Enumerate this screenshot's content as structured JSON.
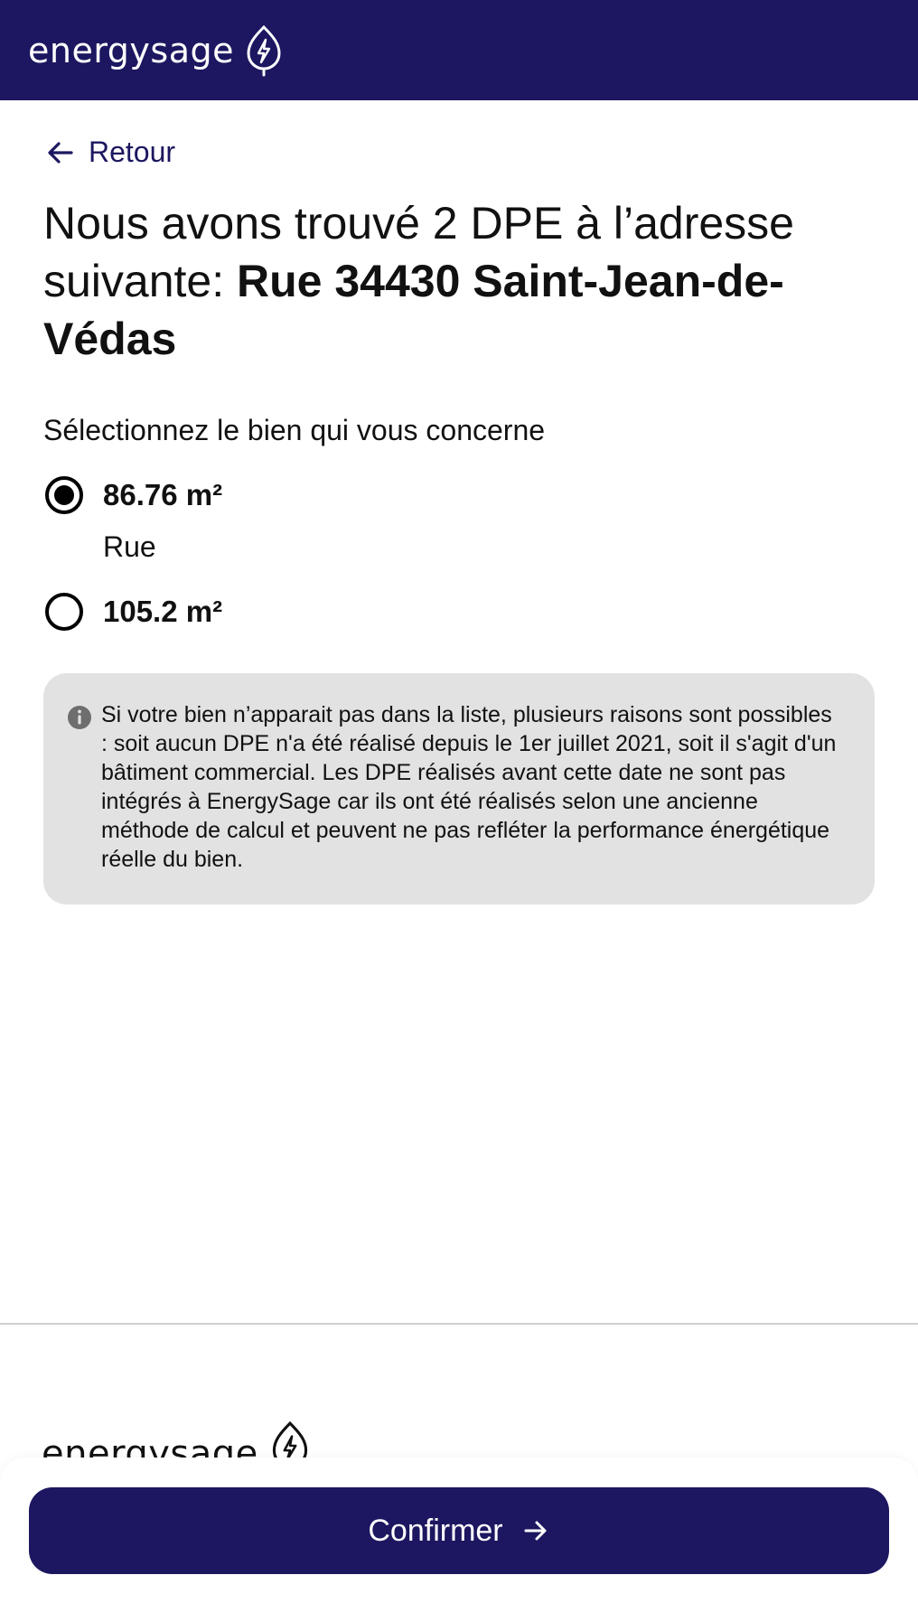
{
  "header": {
    "brand_name": "energysage",
    "logo_icon": "leaf-bolt-icon",
    "background": "#1c1760"
  },
  "nav": {
    "back_label": "Retour",
    "back_icon": "arrow-left-icon"
  },
  "main": {
    "title_prefix": "Nous avons trouvé 2 DPE à l’adresse suivante: ",
    "title_address": "Rue 34430 Saint-Jean-de-Védas",
    "subtitle": "Sélectionnez le bien qui vous concerne",
    "options": [
      {
        "area": "86.76 m²",
        "street": "Rue",
        "selected": true
      },
      {
        "area": "105.2 m²",
        "street": "",
        "selected": false
      }
    ],
    "info_icon": "info-icon",
    "info_text": "Si votre bien n’apparait pas dans la liste, plusieurs raisons sont possibles : soit aucun DPE n'a été réalisé depuis le 1er juillet 2021, soit il s'agit d'un bâtiment commercial. Les DPE réalisés avant cette date ne sont pas intégrés à EnergySage car ils ont été réalisés selon une ancienne méthode de calcul et peuvent ne pas refléter la performance énergétique réelle du bien."
  },
  "footer": {
    "brand_name": "energysage"
  },
  "actions": {
    "confirm_label": "Confirmer",
    "confirm_icon": "arrow-right-icon",
    "accent": "#1c1760"
  }
}
